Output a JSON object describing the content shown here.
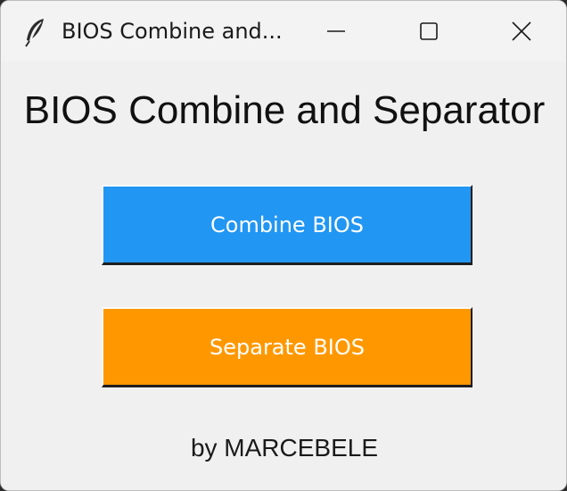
{
  "window": {
    "title": "BIOS Combine and...",
    "icon": "feather-icon",
    "controls": [
      "minimize-icon",
      "maximize-icon",
      "close-icon"
    ]
  },
  "main": {
    "heading": "BIOS Combine and Separator",
    "combine_button": {
      "label": "Combine BIOS",
      "color": "#2196f3"
    },
    "separate_button": {
      "label": "Separate BIOS",
      "color": "#ff9800"
    },
    "footer": "by MARCEBELE"
  }
}
